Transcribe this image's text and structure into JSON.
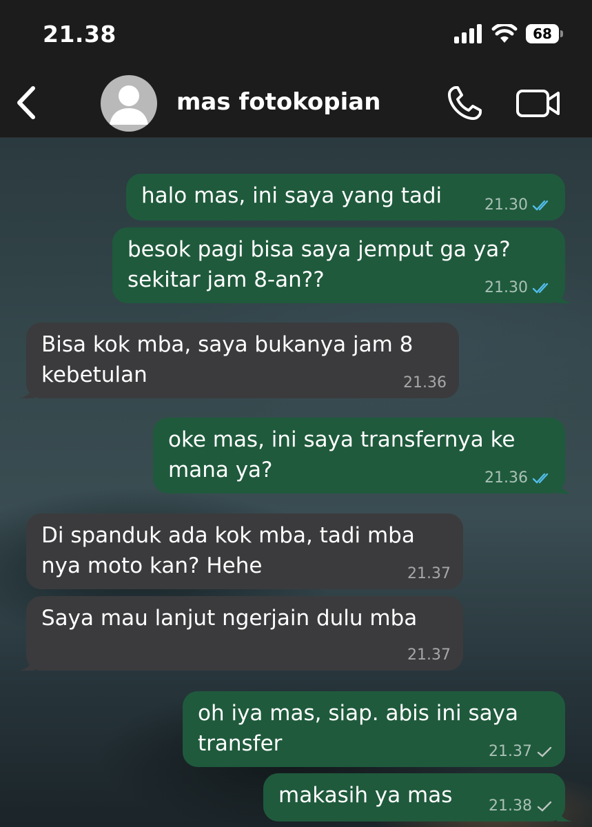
{
  "status_bar": {
    "time": "21.38",
    "battery": "68"
  },
  "header": {
    "contact_name": "mas fotokopian"
  },
  "messages": [
    {
      "direction": "out",
      "text": "halo mas, ini saya yang tadi",
      "time": "21.30",
      "status": "read"
    },
    {
      "direction": "out",
      "text": "besok pagi bisa saya jemput ga ya?\nsekitar jam 8-an??",
      "time": "21.30",
      "status": "read"
    },
    {
      "direction": "in",
      "text": "Bisa kok mba, saya bukanya jam 8\nkebetulan",
      "time": "21.36"
    },
    {
      "direction": "out",
      "text": "oke mas, ini saya transfernya ke\nmana ya?",
      "time": "21.36",
      "status": "read"
    },
    {
      "direction": "in",
      "text": "Di spanduk ada kok mba, tadi mba\nnya moto kan? Hehe",
      "time": "21.37"
    },
    {
      "direction": "in",
      "text": "Saya mau lanjut ngerjain dulu mba",
      "time": "21.37"
    },
    {
      "direction": "out",
      "text": "oh iya mas, siap. abis ini saya\ntransfer",
      "time": "21.37",
      "status": "sent"
    },
    {
      "direction": "out",
      "text": "makasih ya mas",
      "time": "21.38",
      "status": "sent"
    }
  ],
  "colors": {
    "outgoing_bubble": "#1f5a3c",
    "incoming_bubble": "#3b3b3d",
    "read_tick": "#53bdeb",
    "sent_tick": "#bfc6c2"
  },
  "icons": {
    "back": "chevron-left-icon",
    "avatar": "person-placeholder-icon",
    "call": "phone-icon",
    "video": "video-camera-icon",
    "signal": "cellular-signal-icon",
    "wifi": "wifi-icon",
    "battery": "battery-icon"
  }
}
